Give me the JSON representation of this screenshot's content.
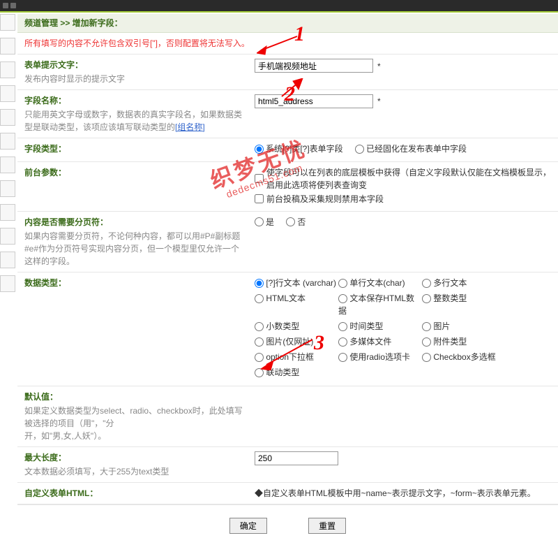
{
  "breadcrumb": "频道管理 >> 增加新字段：",
  "warning": "所有填写的内容不允许包含双引号[\"]，否则配置将无法写入。",
  "rows": {
    "prompt": {
      "title": "表单提示文字：",
      "desc": "发布内容时显示的提示文字",
      "value": "手机端视频地址"
    },
    "name": {
      "title": "字段名称：",
      "desc": "只能用英文字母或数字，数据表的真实字段名，如果数据类型是联动类型，该项应该填写联动类型的",
      "link": "[组名称]",
      "value": "html5_address"
    },
    "type": {
      "title": "字段类型：",
      "opt1": "系统[?]类[?]表单字段",
      "opt2": "已经固化在发布表单中字段"
    },
    "frontend": {
      "title": "前台参数：",
      "line1": "使字段可以在列表的底层模板中获得（自定义字段默认仅能在文档模板显示，启用此选项将使列表查询变",
      "line2": "前台投稿及采集规则禁用本字段"
    },
    "page": {
      "title": "内容是否需要分页符：",
      "desc": "如果内容需要分页符，不论何种内容，都可以用#P#副标题#e#作为分页符号实现内容分页，但一个模型里仅允许一个这样的字段。",
      "yes": "是",
      "no": "否"
    },
    "dtype": {
      "title": "数据类型：",
      "opts": [
        "[?]行文本 (varchar)",
        "单行文本(char)",
        "多行文本",
        "HTML文本",
        "文本保存HTML数据",
        "整数类型",
        "小数类型",
        "时间类型",
        "图片",
        "图片(仅网址)",
        "多媒体文件",
        "附件类型",
        "option下拉框",
        "使用radio选项卡",
        "Checkbox多选框",
        "联动类型"
      ]
    },
    "default": {
      "title": "默认值：",
      "desc1": "如果定义数据类型为select、radio、checkbox时，此处填写被选择的项目（用\"，\"分",
      "desc2": "开，如\"男,女,人妖\"）。"
    },
    "maxlen": {
      "title": "最大长度：",
      "desc": "文本数据必须填写，大于255为text类型",
      "value": "250"
    },
    "html": {
      "title": "自定义表单HTML：",
      "value": "◆自定义表单HTML模板中用~name~表示提示文字，~form~表示表单元素。"
    }
  },
  "buttons": {
    "ok": "确定",
    "reset": "重置"
  },
  "annot": {
    "n1": "1",
    "n2": "2",
    "n3": "3"
  },
  "wm": {
    "cn": "织梦无忧",
    "en": "dedecms51.com"
  }
}
